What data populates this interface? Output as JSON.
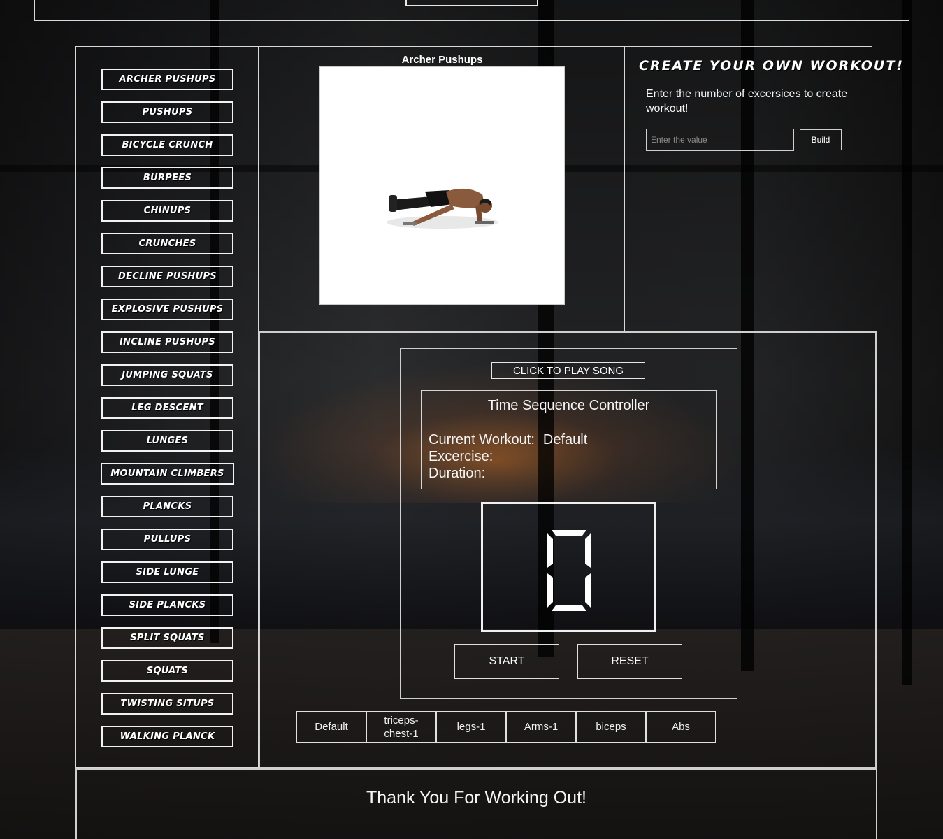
{
  "exercises": [
    "ARCHER PUSHUPS",
    "PUSHUPS",
    "BICYCLE CRUNCH",
    "BURPEES",
    "CHINUPS",
    "CRUNCHES",
    "DECLINE PUSHUPS",
    "EXPLOSIVE PUSHUPS",
    "INCLINE PUSHUPS",
    "JUMPING SQUATS",
    "LEG DESCENT",
    "LUNGES",
    "MOUNTAIN CLIMBERS",
    "PLANCKS",
    "PULLUPS",
    "SIDE LUNGE",
    "SIDE PLANCKS",
    "SPLIT SQUATS",
    "SQUATS",
    "TWISTING SITUPS",
    "WALKING PLANCK"
  ],
  "preview": {
    "title": "Archer Pushups"
  },
  "builder": {
    "title": "Create Your Own Workout!",
    "description": "Enter the number of excersices to create workout!",
    "input_placeholder": "Enter the value",
    "build_label": "Build"
  },
  "controller": {
    "song_button": "CLICK TO PLAY SONG",
    "title": "Time Sequence Controller",
    "current_workout_label": "Current Workout:",
    "current_workout_value": "Default",
    "exercise_label": "Excercise:",
    "duration_label": "Duration:",
    "timer_value": "0",
    "start_label": "START",
    "reset_label": "RESET"
  },
  "workout_tabs": [
    "Default",
    "triceps-chest-1",
    "legs-1",
    "Arms-1",
    "biceps",
    "Abs"
  ],
  "footer": {
    "message": "Thank You For Working Out!"
  }
}
